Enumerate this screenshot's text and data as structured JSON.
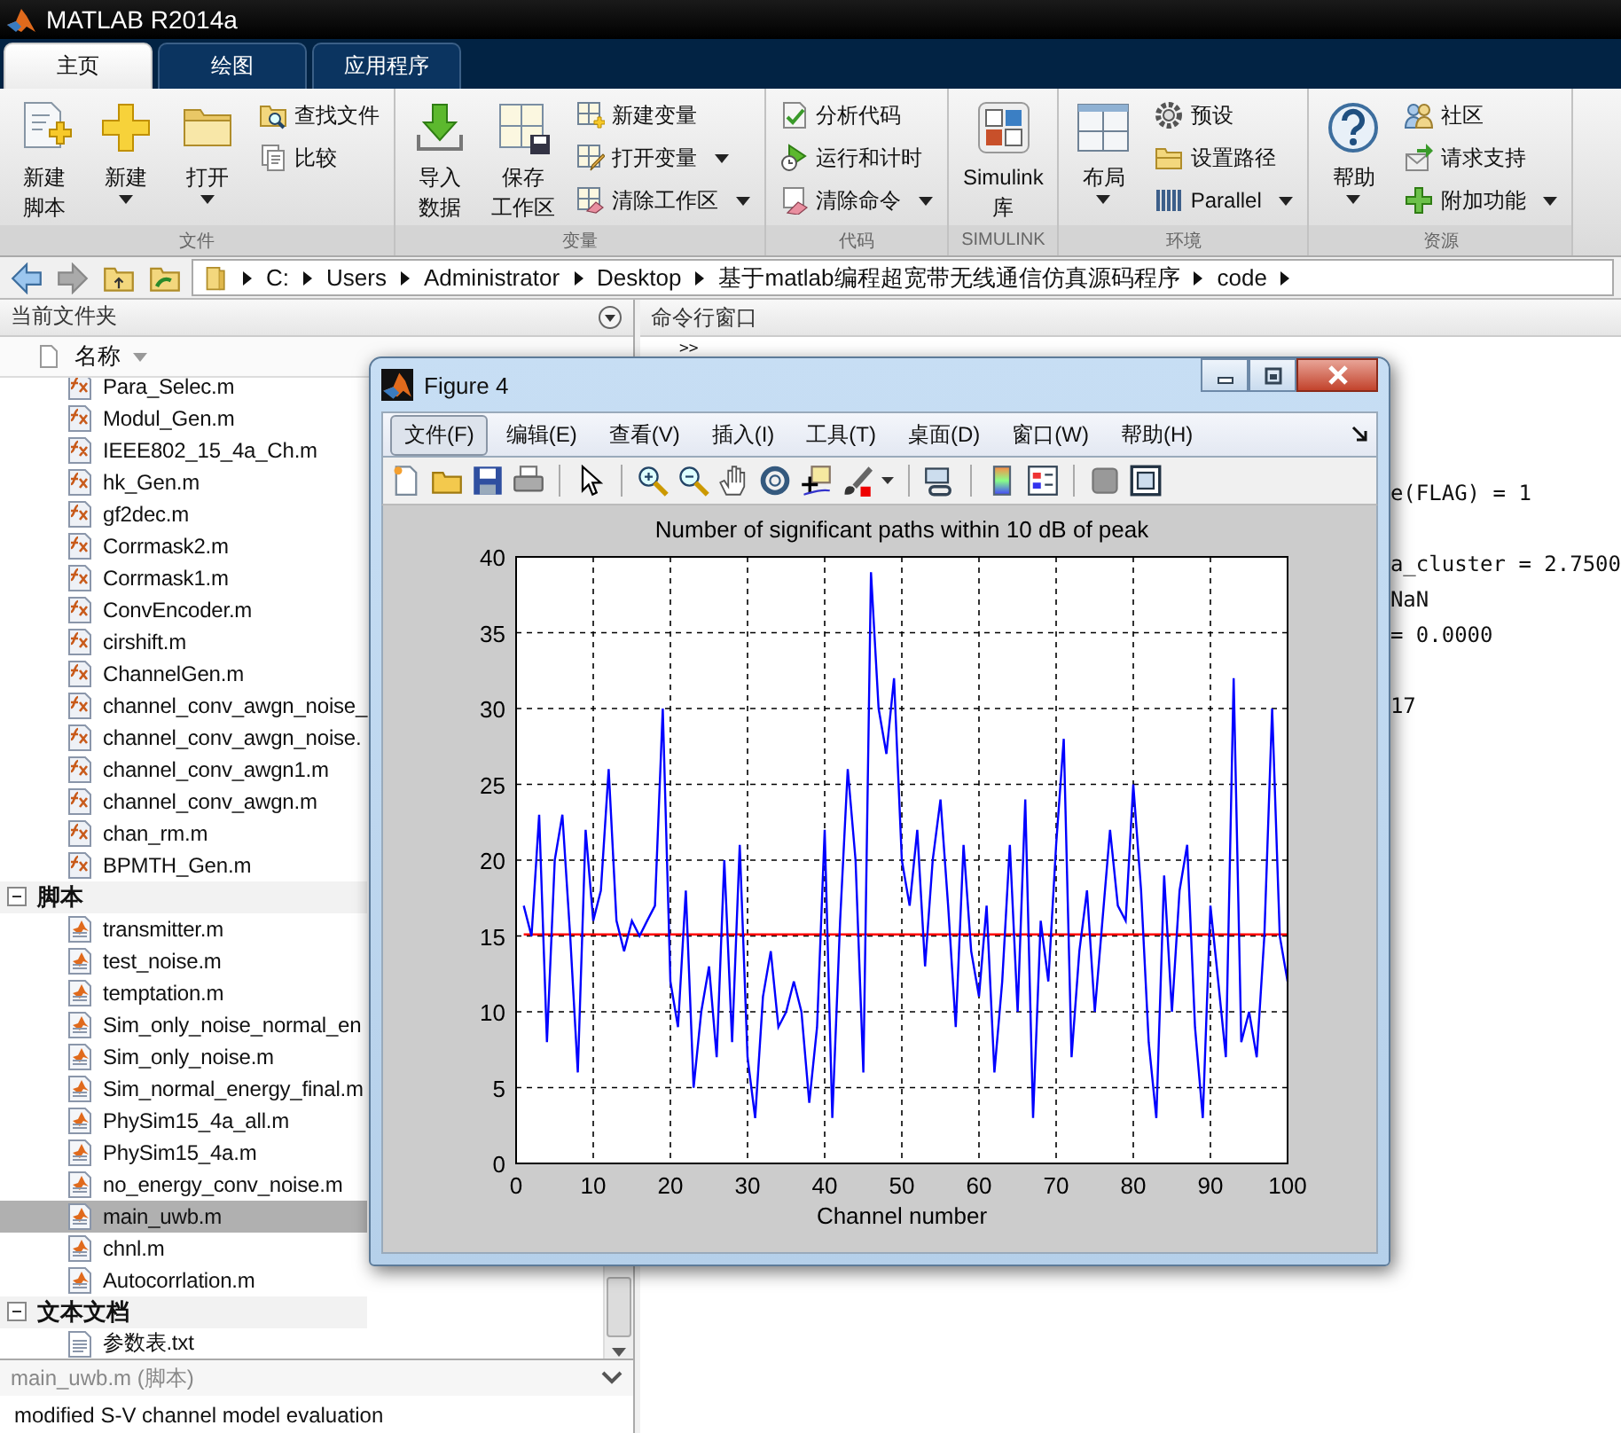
{
  "window": {
    "title": "MATLAB R2014a"
  },
  "tabs": [
    {
      "label": "主页",
      "selected": true
    },
    {
      "label": "绘图",
      "selected": false
    },
    {
      "label": "应用程序",
      "selected": false
    }
  ],
  "ribbon": {
    "groups": [
      {
        "label": "文件",
        "items": [
          {
            "kind": "large",
            "lines": [
              "新建",
              "脚本"
            ],
            "dropdown": false
          },
          {
            "kind": "large",
            "lines": [
              "新建"
            ],
            "dropdown": true
          },
          {
            "kind": "large",
            "lines": [
              "打开"
            ],
            "dropdown": true
          },
          {
            "kind": "stack",
            "items": [
              {
                "label": "查找文件",
                "dropdown": false
              },
              {
                "label": "比较",
                "dropdown": false
              }
            ]
          }
        ]
      },
      {
        "label": "变量",
        "items": [
          {
            "kind": "large",
            "lines": [
              "导入",
              "数据"
            ],
            "dropdown": false
          },
          {
            "kind": "large",
            "lines": [
              "保存",
              "工作区"
            ],
            "dropdown": false
          },
          {
            "kind": "stack",
            "items": [
              {
                "label": "新建变量",
                "dropdown": false
              },
              {
                "label": "打开变量",
                "dropdown": true
              },
              {
                "label": "清除工作区",
                "dropdown": true
              }
            ]
          }
        ]
      },
      {
        "label": "代码",
        "items": [
          {
            "kind": "stack",
            "items": [
              {
                "label": "分析代码",
                "dropdown": false
              },
              {
                "label": "运行和计时",
                "dropdown": false
              },
              {
                "label": "清除命令",
                "dropdown": true
              }
            ]
          }
        ]
      },
      {
        "label": "SIMULINK",
        "items": [
          {
            "kind": "large",
            "lines": [
              "Simulink",
              "库"
            ],
            "dropdown": false
          }
        ]
      },
      {
        "label": "环境",
        "items": [
          {
            "kind": "large",
            "lines": [
              "布局"
            ],
            "dropdown": true
          },
          {
            "kind": "stack",
            "items": [
              {
                "label": "预设",
                "dropdown": false
              },
              {
                "label": "设置路径",
                "dropdown": false
              },
              {
                "label": "Parallel",
                "dropdown": true
              }
            ]
          }
        ]
      },
      {
        "label": "资源",
        "items": [
          {
            "kind": "large",
            "lines": [
              "帮助"
            ],
            "dropdown": true
          },
          {
            "kind": "stack",
            "items": [
              {
                "label": "社区",
                "dropdown": false
              },
              {
                "label": "请求支持",
                "dropdown": false
              },
              {
                "label": "附加功能",
                "dropdown": true
              }
            ]
          }
        ]
      }
    ]
  },
  "path": [
    "C:",
    "Users",
    "Administrator",
    "Desktop",
    "基于matlab编程超宽带无线通信仿真源码程序",
    "code"
  ],
  "current_folder": {
    "title": "当前文件夹",
    "column": "名称",
    "items": [
      {
        "name": "Para_Selec.m",
        "kind": "function",
        "selected": false
      },
      {
        "name": "Modul_Gen.m",
        "kind": "function",
        "selected": false
      },
      {
        "name": "IEEE802_15_4a_Ch.m",
        "kind": "function",
        "selected": false
      },
      {
        "name": "hk_Gen.m",
        "kind": "function",
        "selected": false
      },
      {
        "name": "gf2dec.m",
        "kind": "function",
        "selected": false
      },
      {
        "name": "Corrmask2.m",
        "kind": "function",
        "selected": false
      },
      {
        "name": "Corrmask1.m",
        "kind": "function",
        "selected": false
      },
      {
        "name": "ConvEncoder.m",
        "kind": "function",
        "selected": false
      },
      {
        "name": "cirshift.m",
        "kind": "function",
        "selected": false
      },
      {
        "name": "ChannelGen.m",
        "kind": "function",
        "selected": false
      },
      {
        "name": "channel_conv_awgn_noise_",
        "kind": "function",
        "selected": false
      },
      {
        "name": "channel_conv_awgn_noise.",
        "kind": "function",
        "selected": false
      },
      {
        "name": "channel_conv_awgn1.m",
        "kind": "function",
        "selected": false
      },
      {
        "name": "channel_conv_awgn.m",
        "kind": "function",
        "selected": false
      },
      {
        "name": "chan_rm.m",
        "kind": "function",
        "selected": false
      },
      {
        "name": "BPMTH_Gen.m",
        "kind": "function",
        "selected": false
      }
    ],
    "groups": [
      {
        "label": "脚本",
        "expanded": true,
        "items": [
          {
            "name": "transmitter.m",
            "kind": "script",
            "selected": false
          },
          {
            "name": "test_noise.m",
            "kind": "script",
            "selected": false
          },
          {
            "name": "temptation.m",
            "kind": "script",
            "selected": false
          },
          {
            "name": "Sim_only_noise_normal_en",
            "kind": "script",
            "selected": false
          },
          {
            "name": "Sim_only_noise.m",
            "kind": "script",
            "selected": false
          },
          {
            "name": "Sim_normal_energy_final.m",
            "kind": "script",
            "selected": false
          },
          {
            "name": "PhySim15_4a_all.m",
            "kind": "script",
            "selected": false
          },
          {
            "name": "PhySim15_4a.m",
            "kind": "script",
            "selected": false
          },
          {
            "name": "no_energy_conv_noise.m",
            "kind": "script",
            "selected": false
          },
          {
            "name": "main_uwb.m",
            "kind": "script",
            "selected": true
          },
          {
            "name": "chnl.m",
            "kind": "script",
            "selected": false
          },
          {
            "name": "Autocorrlation.m",
            "kind": "script",
            "selected": false
          }
        ]
      },
      {
        "label": "文本文档",
        "expanded": true,
        "items": [
          {
            "name": "参数表.txt",
            "kind": "text",
            "selected": false
          }
        ]
      }
    ],
    "details": {
      "title": "main_uwb.m (脚本)",
      "description": "modified S-V channel model evaluation"
    }
  },
  "command_window": {
    "title": "命令行窗口",
    "prompt": ">>",
    "blocks": [
      [
        "e(FLAG) = 1"
      ],
      [
        "a_cluster = 2.7500",
        "NaN",
        "= 0.0000"
      ],
      [
        "17"
      ]
    ]
  },
  "figure": {
    "title": "Figure 4",
    "menu": [
      {
        "label": "文件(F)",
        "selected": true
      },
      {
        "label": "编辑(E)",
        "selected": false
      },
      {
        "label": "查看(V)",
        "selected": false
      },
      {
        "label": "插入(I)",
        "selected": false
      },
      {
        "label": "工具(T)",
        "selected": false
      },
      {
        "label": "桌面(D)",
        "selected": false
      },
      {
        "label": "窗口(W)",
        "selected": false
      },
      {
        "label": "帮助(H)",
        "selected": false
      }
    ],
    "chart_data": {
      "type": "line",
      "title": "Number of significant paths within 10 dB of peak",
      "xlabel": "Channel number",
      "x": [
        1,
        2,
        3,
        4,
        5,
        6,
        7,
        8,
        9,
        10,
        11,
        12,
        13,
        14,
        15,
        16,
        17,
        18,
        19,
        20,
        21,
        22,
        23,
        24,
        25,
        26,
        27,
        28,
        29,
        30,
        31,
        32,
        33,
        34,
        35,
        36,
        37,
        38,
        39,
        40,
        41,
        42,
        43,
        44,
        45,
        46,
        47,
        48,
        49,
        50,
        51,
        52,
        53,
        54,
        55,
        56,
        57,
        58,
        59,
        60,
        61,
        62,
        63,
        64,
        65,
        66,
        67,
        68,
        69,
        70,
        71,
        72,
        73,
        74,
        75,
        76,
        77,
        78,
        79,
        80,
        81,
        82,
        83,
        84,
        85,
        86,
        87,
        88,
        89,
        90,
        91,
        92,
        93,
        94,
        95,
        96,
        97,
        98,
        99,
        100
      ],
      "series": [
        {
          "color": "#ff0000",
          "values": [
            15.1,
            15.1,
            15.1,
            15.1,
            15.1,
            15.1,
            15.1,
            15.1,
            15.1,
            15.1,
            15.1,
            15.1,
            15.1,
            15.1,
            15.1,
            15.1,
            15.1,
            15.1,
            15.1,
            15.1,
            15.1,
            15.1,
            15.1,
            15.1,
            15.1,
            15.1,
            15.1,
            15.1,
            15.1,
            15.1,
            15.1,
            15.1,
            15.1,
            15.1,
            15.1,
            15.1,
            15.1,
            15.1,
            15.1,
            15.1,
            15.1,
            15.1,
            15.1,
            15.1,
            15.1,
            15.1,
            15.1,
            15.1,
            15.1,
            15.1,
            15.1,
            15.1,
            15.1,
            15.1,
            15.1,
            15.1,
            15.1,
            15.1,
            15.1,
            15.1,
            15.1,
            15.1,
            15.1,
            15.1,
            15.1,
            15.1,
            15.1,
            15.1,
            15.1,
            15.1,
            15.1,
            15.1,
            15.1,
            15.1,
            15.1,
            15.1,
            15.1,
            15.1,
            15.1,
            15.1,
            15.1,
            15.1,
            15.1,
            15.1,
            15.1,
            15.1,
            15.1,
            15.1,
            15.1,
            15.1,
            15.1,
            15.1,
            15.1,
            15.1,
            15.1,
            15.1,
            15.1,
            15.1,
            15.1,
            15.1
          ]
        },
        {
          "color": "#0000ff",
          "values": [
            17,
            15,
            23,
            8,
            20,
            23,
            15,
            6,
            22,
            16,
            18,
            26,
            16,
            14,
            16,
            15,
            16,
            17,
            30,
            12,
            9,
            18,
            5,
            10,
            13,
            7,
            20,
            8,
            21,
            7,
            3,
            11,
            14,
            9,
            10,
            12,
            10,
            4,
            9,
            22,
            3,
            16,
            26,
            20,
            6,
            39,
            30,
            27,
            32,
            20,
            17,
            22,
            13,
            20,
            24,
            17,
            9,
            21,
            14,
            11,
            17,
            6,
            12,
            21,
            10,
            24,
            3,
            16,
            12,
            21,
            28,
            7,
            14,
            18,
            10,
            16,
            22,
            17,
            16,
            25,
            18,
            8,
            3,
            19,
            10,
            18,
            21,
            9,
            3,
            17,
            12,
            7,
            32,
            8,
            10,
            7,
            15,
            30,
            15,
            12
          ]
        }
      ],
      "grid": true,
      "xlim": [
        0,
        100
      ],
      "ylim": [
        0,
        40
      ],
      "xticks": [
        0,
        10,
        20,
        30,
        40,
        50,
        60,
        70,
        80,
        90,
        100
      ],
      "yticks": [
        0,
        5,
        10,
        15,
        20,
        25,
        30,
        35,
        40
      ]
    }
  }
}
